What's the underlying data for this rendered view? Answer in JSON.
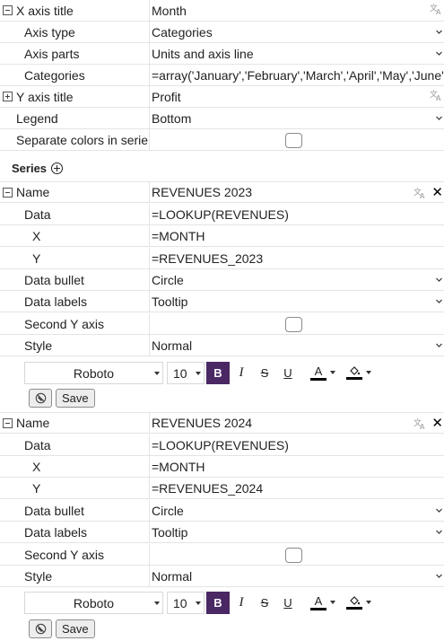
{
  "chart_settings": {
    "x_axis_title": {
      "label": "X axis title",
      "value": "Month"
    },
    "axis_type": {
      "label": "Axis type",
      "value": "Categories"
    },
    "axis_parts": {
      "label": "Axis parts",
      "value": "Units and axis line"
    },
    "categories": {
      "label": "Categories",
      "value": "=array('January','February','March','April','May','June','J"
    },
    "y_axis_title": {
      "label": "Y axis title",
      "value": "Profit"
    },
    "legend": {
      "label": "Legend",
      "value": "Bottom"
    },
    "separate_colors": {
      "label": "Separate colors in serie",
      "checked": false
    }
  },
  "series_header": "Series",
  "series": [
    {
      "name_label": "Name",
      "name": "REVENUES 2023",
      "data_label": "Data",
      "data": "=LOOKUP(REVENUES)",
      "x_label": "X",
      "x": "=MONTH",
      "y_label": "Y",
      "y": "=REVENUES_2023",
      "bullet_label": "Data bullet",
      "bullet": "Circle",
      "labels_label": "Data labels",
      "labels": "Tooltip",
      "second_y_label": "Second Y axis",
      "second_y_checked": false,
      "style_label": "Style",
      "style": "Normal",
      "font": "Roboto",
      "font_size": "10",
      "save_label": "Save"
    },
    {
      "name_label": "Name",
      "name": "REVENUES 2024",
      "data_label": "Data",
      "data": "=LOOKUP(REVENUES)",
      "x_label": "X",
      "x": "=MONTH",
      "y_label": "Y",
      "y": "=REVENUES_2024",
      "bullet_label": "Data bullet",
      "bullet": "Circle",
      "labels_label": "Data labels",
      "labels": "Tooltip",
      "second_y_label": "Second Y axis",
      "second_y_checked": false,
      "style_label": "Style",
      "style": "Normal",
      "font": "Roboto",
      "font_size": "10",
      "save_label": "Save"
    }
  ],
  "colors": {
    "bold_active": "#4a2864",
    "grid_line": "#e4e4e4"
  }
}
